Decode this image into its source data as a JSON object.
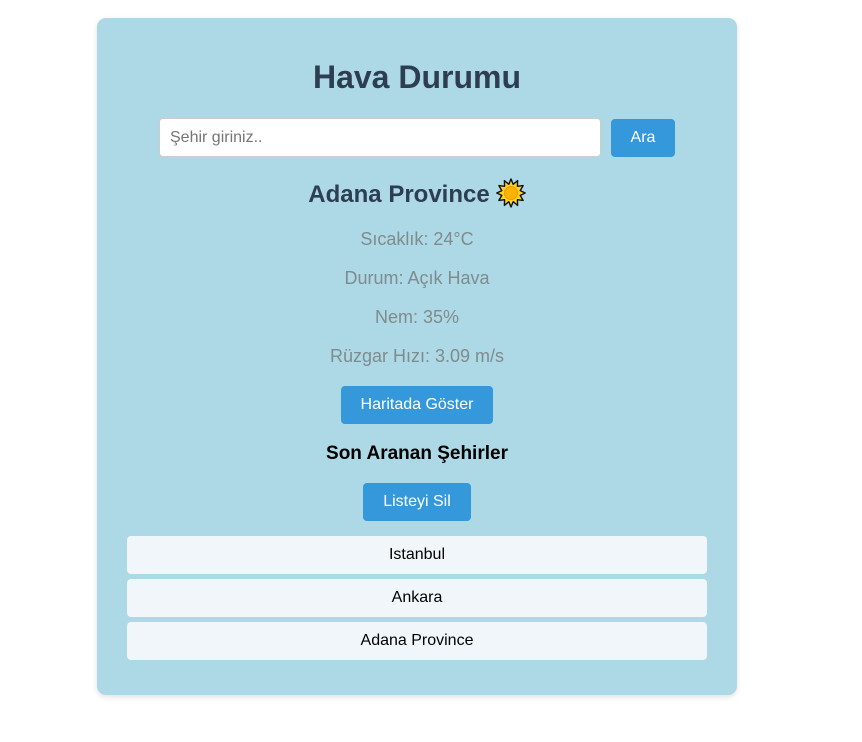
{
  "app": {
    "title": "Hava Durumu"
  },
  "search": {
    "placeholder": "Şehir giriniz..",
    "value": "",
    "button_label": "Ara"
  },
  "weather": {
    "city": "Adana Province",
    "icon": "sun-icon",
    "temperature": "Sıcaklık: 24°C",
    "condition": "Durum: Açık Hava",
    "humidity": "Nem: 35%",
    "wind": "Rüzgar Hızı: 3.09 m/s"
  },
  "map": {
    "button_label": "Haritada Göster"
  },
  "recent": {
    "title": "Son Aranan Şehirler",
    "clear_label": "Listeyi Sil",
    "items": [
      {
        "label": "Istanbul"
      },
      {
        "label": "Ankara"
      },
      {
        "label": "Adana Province"
      }
    ]
  },
  "colors": {
    "card_background": "#add8e6",
    "accent": "#3498db",
    "heading": "#2c3e50",
    "muted_text": "#7f8c8d",
    "list_item_background": "#f0f6f9",
    "sun_fill": "#ffd21f"
  }
}
